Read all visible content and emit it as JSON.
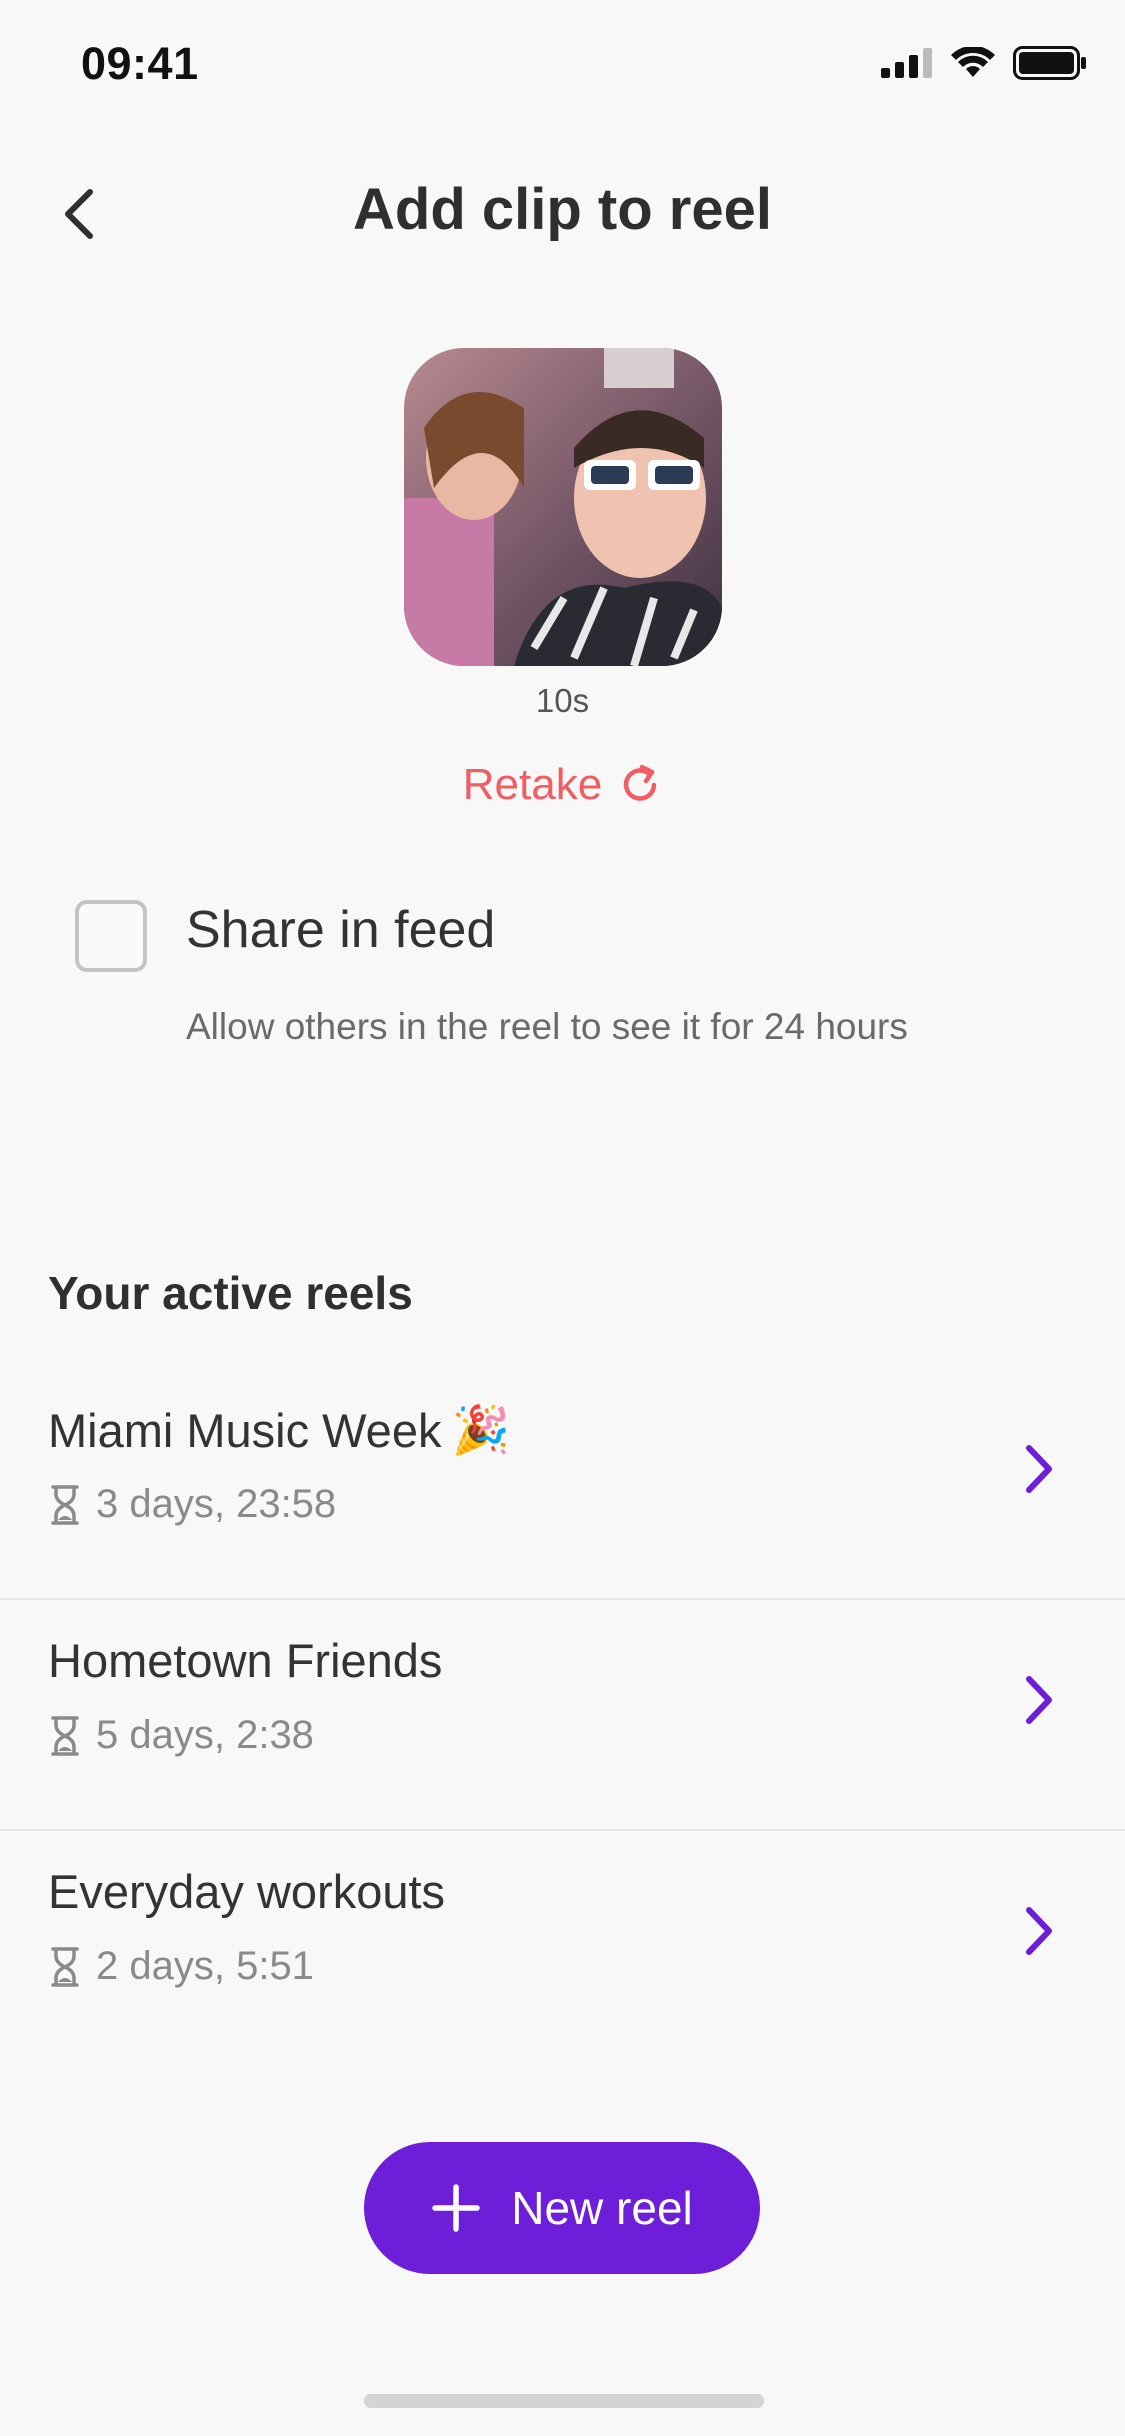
{
  "status_bar": {
    "time": "09:41"
  },
  "header": {
    "title": "Add clip to reel"
  },
  "clip": {
    "duration": "10s",
    "retake_label": "Retake"
  },
  "share": {
    "title": "Share in feed",
    "description": "Allow others in the reel to see it for 24 hours",
    "checked": false
  },
  "reels": {
    "section_title": "Your active reels",
    "items": [
      {
        "name": "Miami Music Week",
        "emoji": "🎉",
        "time_left": "3 days, 23:58"
      },
      {
        "name": "Hometown Friends",
        "emoji": "",
        "time_left": "5 days, 2:38"
      },
      {
        "name": "Everyday workouts",
        "emoji": "",
        "time_left": "2 days, 5:51"
      }
    ]
  },
  "actions": {
    "new_reel_label": "New reel"
  },
  "colors": {
    "accent": "#6c1ed9",
    "retake": "#f25c63",
    "chevron": "#6c1ed9"
  }
}
